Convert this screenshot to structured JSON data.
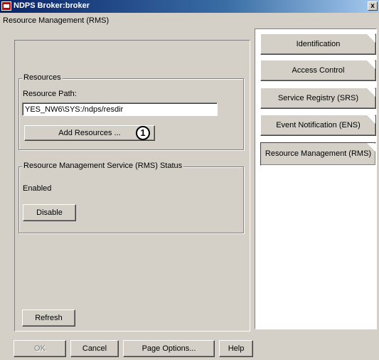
{
  "window": {
    "title": "NDPS Broker:broker",
    "close_glyph": "x"
  },
  "main": {
    "heading": "Resource Management (RMS)",
    "resources": {
      "legend": "Resources",
      "path_label": "Resource Path:",
      "path_value": "YES_NW6\\SYS:/ndps/resdir",
      "add_button": "Add Resources ...",
      "callout": "1"
    },
    "status": {
      "legend": "Resource Management Service (RMS) Status",
      "state": "Enabled",
      "disable_button": "Disable"
    },
    "refresh_button": "Refresh"
  },
  "sidebar": {
    "tabs": [
      {
        "label": "Identification"
      },
      {
        "label": "Access Control"
      },
      {
        "label": "Service Registry (SRS)"
      },
      {
        "label": "Event Notification (ENS)"
      },
      {
        "label": "Resource Management (RMS)"
      }
    ]
  },
  "footer": {
    "ok": "OK",
    "cancel": "Cancel",
    "page_options": "Page Options...",
    "help": "Help"
  }
}
